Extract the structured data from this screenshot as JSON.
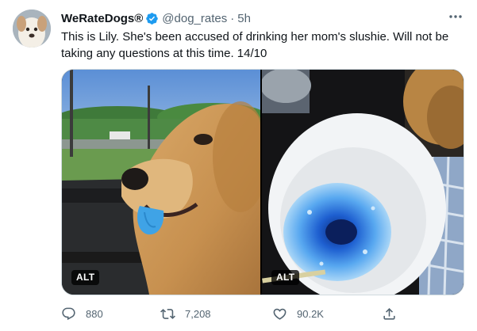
{
  "tweet": {
    "display_name": "WeRateDogs®",
    "handle": "@dog_rates",
    "separator": "·",
    "time": "5h",
    "text": "This is Lily. She's been accused of drinking her mom's slushie. Will not be taking any questions at this time. 14/10",
    "media": [
      {
        "alt_badge": "ALT"
      },
      {
        "alt_badge": "ALT"
      }
    ]
  },
  "actions": {
    "replies": "880",
    "retweets": "7,208",
    "likes": "90.2K"
  },
  "icons": {
    "verified": "verified-badge-icon",
    "more": "more-options-icon",
    "reply": "reply-icon",
    "retweet": "retweet-icon",
    "like": "heart-icon",
    "share": "share-icon"
  },
  "colors": {
    "verified": "#1d9bf0",
    "secondary_text": "#536471",
    "primary_text": "#0f1419"
  }
}
